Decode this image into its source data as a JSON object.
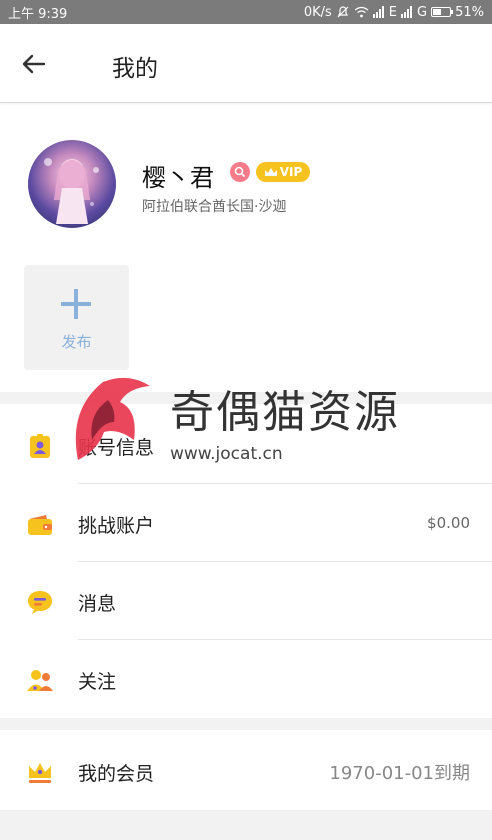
{
  "status_bar": {
    "time": "上午 9:39",
    "network": "0K/s",
    "signal": "E",
    "signal2": "G",
    "battery": "51%",
    "battery_level": 0.51
  },
  "header": {
    "title": "我的",
    "back_icon": "arrow-left-icon"
  },
  "profile": {
    "username": "樱丶君",
    "location": "阿拉伯联合酋长国·沙迦",
    "vip_label": "VIP",
    "badge_icon": "search-badge-icon"
  },
  "publish": {
    "label": "发布"
  },
  "menu": {
    "account_info": {
      "label": "账号信息",
      "icon": "id-card-icon"
    },
    "challenge_account": {
      "label": "挑战账户",
      "value": "$0.00",
      "icon": "wallet-icon"
    },
    "messages": {
      "label": "消息",
      "icon": "chat-bubble-icon"
    },
    "follow": {
      "label": "关注",
      "icon": "users-icon"
    },
    "membership": {
      "label": "我的会员",
      "value": "1970-01-01到期",
      "icon": "crown-icon"
    }
  },
  "watermark": {
    "text": "奇偶猫资源",
    "url": "www.jocat.cn"
  },
  "colors": {
    "accent_yellow": "#f6c21d",
    "accent_blue": "#8ab0dc",
    "status_bar": "#7b7b7b",
    "band": "#f2f2f2"
  }
}
